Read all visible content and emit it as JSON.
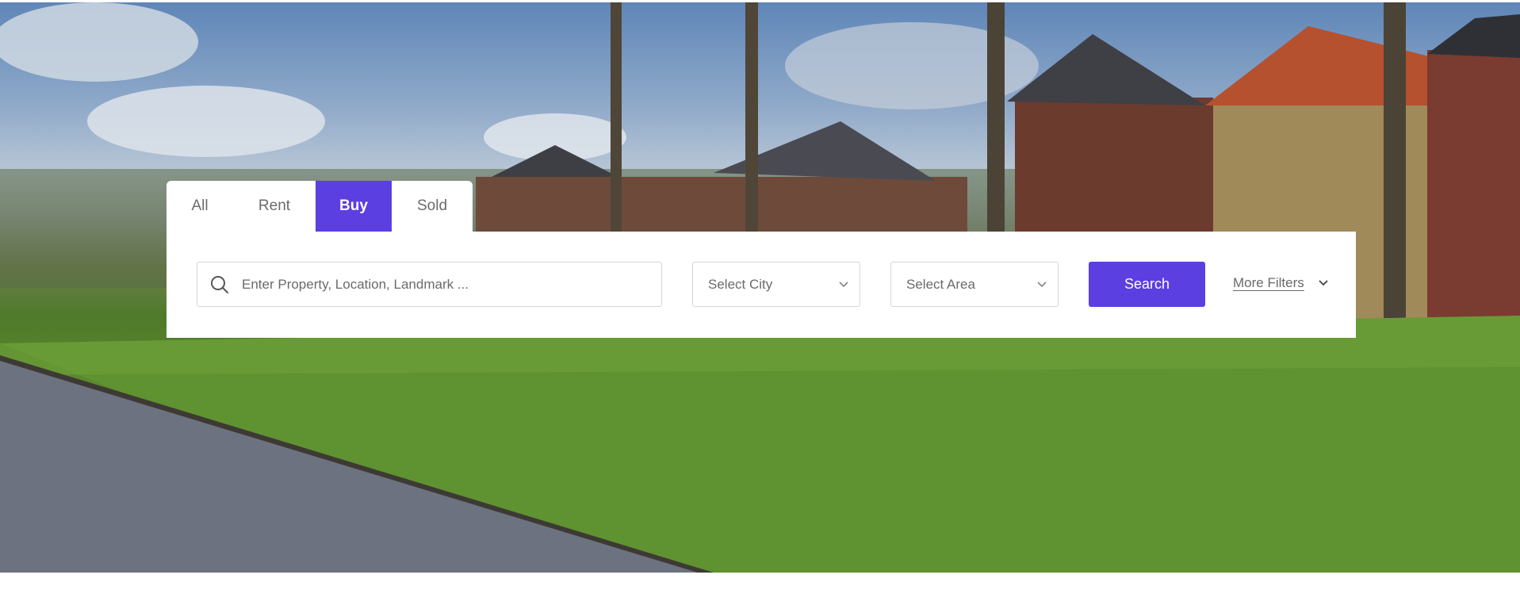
{
  "hero": {
    "colors": {
      "sky": "#5f86b8",
      "grass": "#5d8e2d",
      "water": "#6c7280",
      "brick": "#6b3b2e"
    }
  },
  "search": {
    "tabs": [
      {
        "label": "All",
        "active": false
      },
      {
        "label": "Rent",
        "active": false
      },
      {
        "label": "Buy",
        "active": true
      },
      {
        "label": "Sold",
        "active": false
      }
    ],
    "input_placeholder": "Enter Property, Location, Landmark ...",
    "input_value": "",
    "city_select": "Select City",
    "area_select": "Select Area",
    "search_button": "Search",
    "more_filters": "More Filters",
    "accent_color": "#5b3fe0"
  }
}
